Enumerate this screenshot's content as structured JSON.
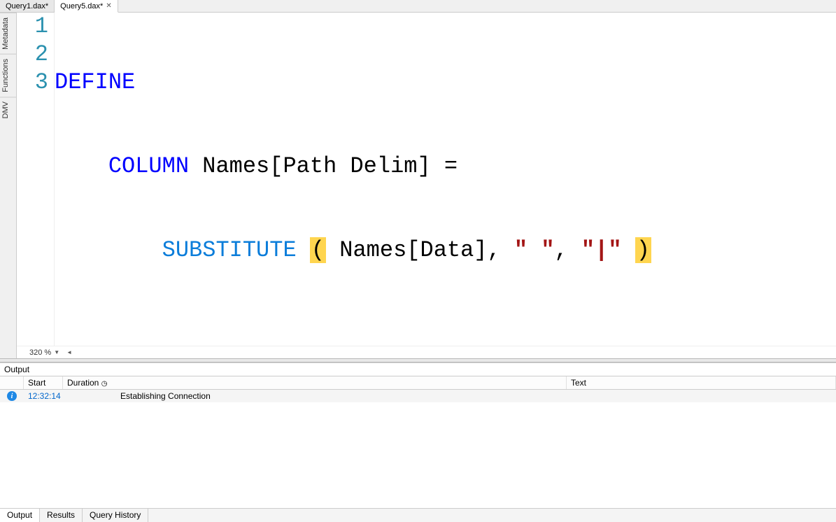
{
  "file_tabs": [
    {
      "label": "Query1.dax*",
      "active": false
    },
    {
      "label": "Query5.dax*",
      "active": true
    }
  ],
  "side_tabs": [
    "Metadata",
    "Functions",
    "DMV"
  ],
  "editor": {
    "zoom_label": "320 %",
    "lines": {
      "l1": {
        "num": "1",
        "kw": "DEFINE"
      },
      "l2": {
        "num": "2",
        "indent": "    ",
        "kw": "COLUMN",
        "rest": " Names[Path Delim] ="
      },
      "l3": {
        "num": "3",
        "indent": "        ",
        "func": "SUBSTITUTE",
        "sp1": " ",
        "open": "(",
        "arg1": " Names[Data], ",
        "str1": "\" \"",
        "comma": ", ",
        "str2": "\"|\"",
        "sp2": " ",
        "close": ")"
      }
    }
  },
  "output": {
    "title": "Output",
    "headers": {
      "start": "Start",
      "duration": "Duration",
      "text": "Text"
    },
    "rows": [
      {
        "start": "12:32:14",
        "duration": "",
        "text": "Establishing Connection"
      }
    ]
  },
  "bottom_tabs": [
    {
      "label": "Output",
      "active": true
    },
    {
      "label": "Results",
      "active": false
    },
    {
      "label": "Query History",
      "active": false
    }
  ]
}
